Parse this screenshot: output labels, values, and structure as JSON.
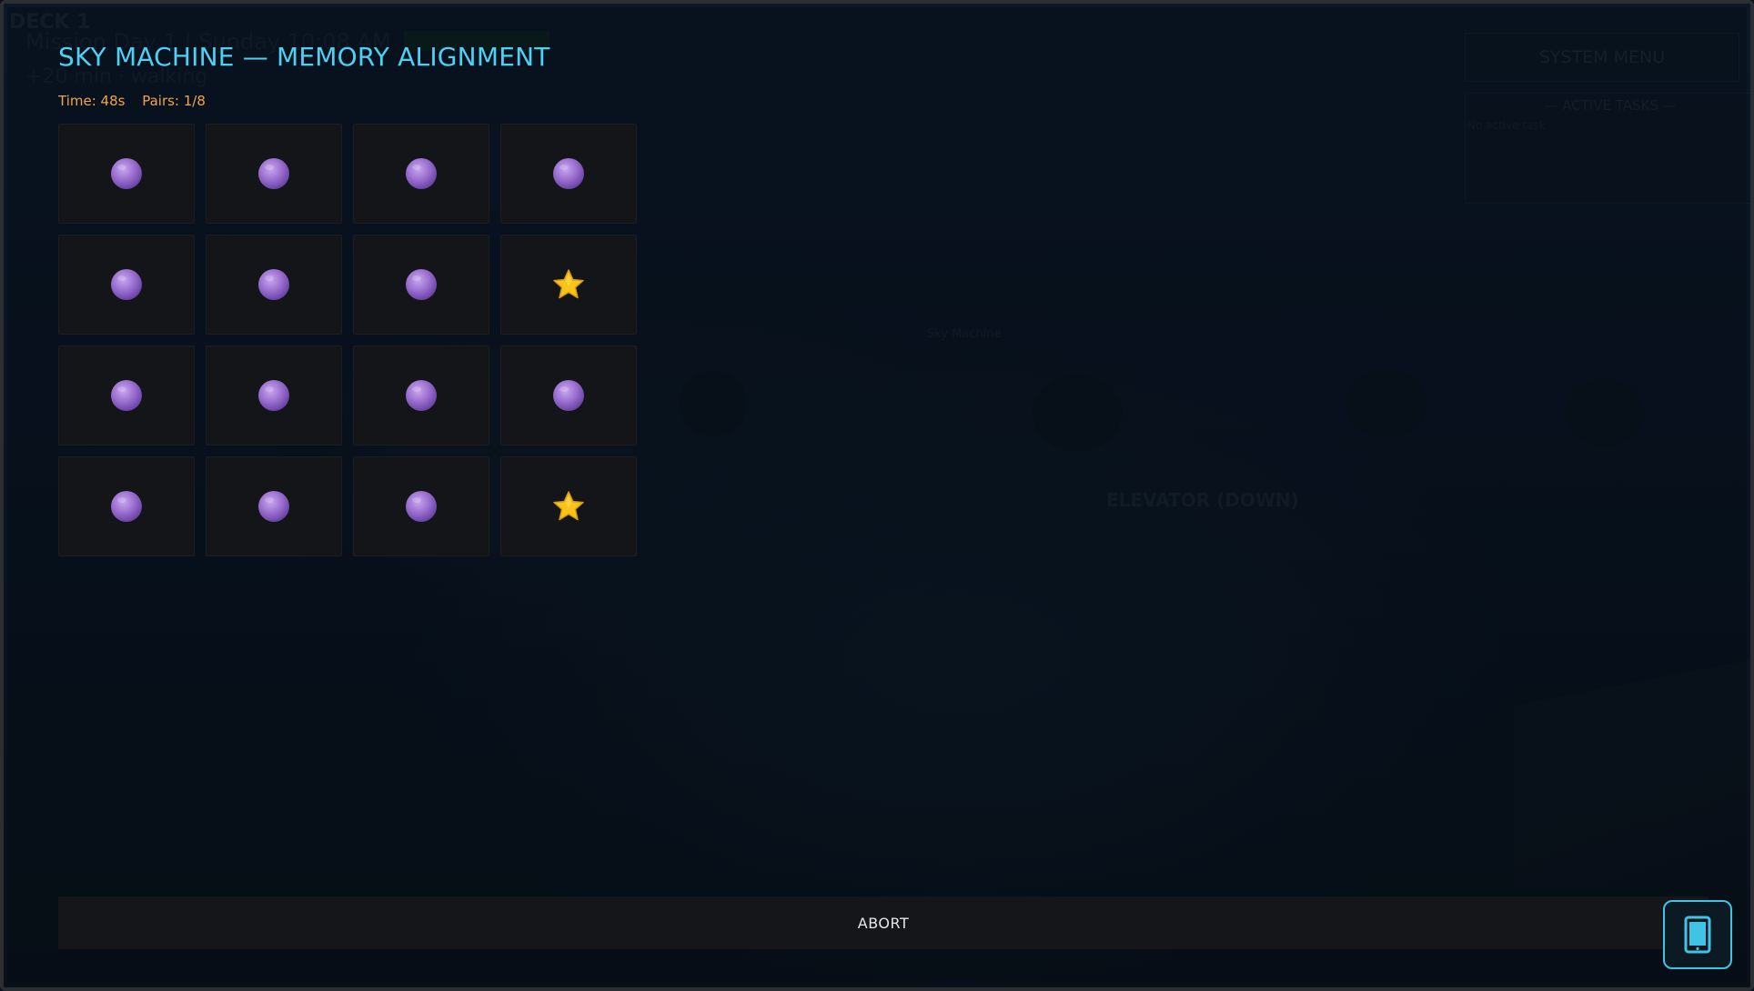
{
  "background": {
    "deck_label": "DECK 1",
    "mission_text": "Mission Day 1  |  Sunday 10:08 AM",
    "meta_text": "+20 min  ·  walking",
    "system_menu_label": "SYSTEM MENU",
    "tasks_title": "— ACTIVE TASKS —",
    "tasks_empty": "No active task",
    "sky_label": "Sky Machine",
    "elevator_label": "ELEVATOR (DOWN)"
  },
  "game": {
    "title": "SKY MACHINE — MEMORY ALIGNMENT",
    "time_text": "Time: 48s",
    "pairs_text": "Pairs: 1/8",
    "cards": [
      {
        "state": "hidden",
        "icon": "orb-icon"
      },
      {
        "state": "hidden",
        "icon": "orb-icon"
      },
      {
        "state": "hidden",
        "icon": "orb-icon"
      },
      {
        "state": "hidden",
        "icon": "orb-icon"
      },
      {
        "state": "hidden",
        "icon": "orb-icon"
      },
      {
        "state": "hidden",
        "icon": "orb-icon"
      },
      {
        "state": "hidden",
        "icon": "orb-icon"
      },
      {
        "state": "matched",
        "icon": "star-icon"
      },
      {
        "state": "hidden",
        "icon": "orb-icon"
      },
      {
        "state": "hidden",
        "icon": "orb-icon"
      },
      {
        "state": "hidden",
        "icon": "orb-icon"
      },
      {
        "state": "hidden",
        "icon": "orb-icon"
      },
      {
        "state": "hidden",
        "icon": "orb-icon"
      },
      {
        "state": "hidden",
        "icon": "orb-icon"
      },
      {
        "state": "hidden",
        "icon": "orb-icon"
      },
      {
        "state": "matched",
        "icon": "star-icon"
      }
    ],
    "abort_label": "ABORT",
    "device_icon": "tablet-icon"
  },
  "colors": {
    "title": "#4fd0f2",
    "stats": "#f0a44a",
    "orb": "#9b6fd0",
    "star": "#f5c518",
    "accent": "#3fc4e6"
  }
}
